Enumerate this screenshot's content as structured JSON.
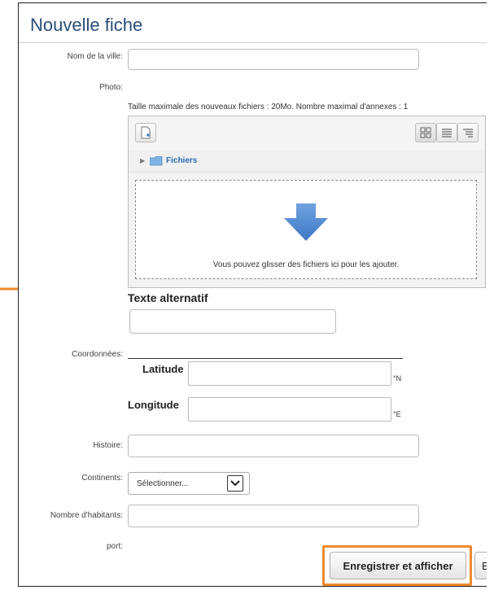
{
  "form": {
    "title": "Nouvelle fiche",
    "fields": {
      "city_name_label": "Nom de la ville:",
      "photo_label": "Photo:",
      "photo_info": "Taille maximale des nouveaux fichiers : 20Mo. Nombre maximal d'annexes : 1",
      "file_folder_label": "Fichiers",
      "dropzone_text": "Vous pouvez glisser des fichiers ici pour les ajouter.",
      "alt_text_label": "Texte alternatif",
      "coordinates_label": "Coordonnées:",
      "latitude_label": "Latitude",
      "latitude_unit": "°N",
      "longitude_label": "Longitude",
      "longitude_unit": "°E",
      "history_label": "Histoire:",
      "continents_label": "Continents:",
      "continents_selected": "Sélectionner...",
      "population_label": "Nombre d'habitants:",
      "port_label": "port:"
    },
    "buttons": {
      "save_and_show": "Enregistrer et afficher",
      "next_truncated": "E"
    }
  },
  "annotations": {
    "arrow_color": "#f08a2c",
    "highlight_color": "#f08a2c"
  },
  "icons": {
    "add_file": "add-file-icon",
    "view_icons": "icons-view-icon",
    "view_list": "list-view-icon",
    "view_tree": "tree-view-icon",
    "folder": "folder-icon",
    "drop_arrow": "down-arrow-icon"
  }
}
